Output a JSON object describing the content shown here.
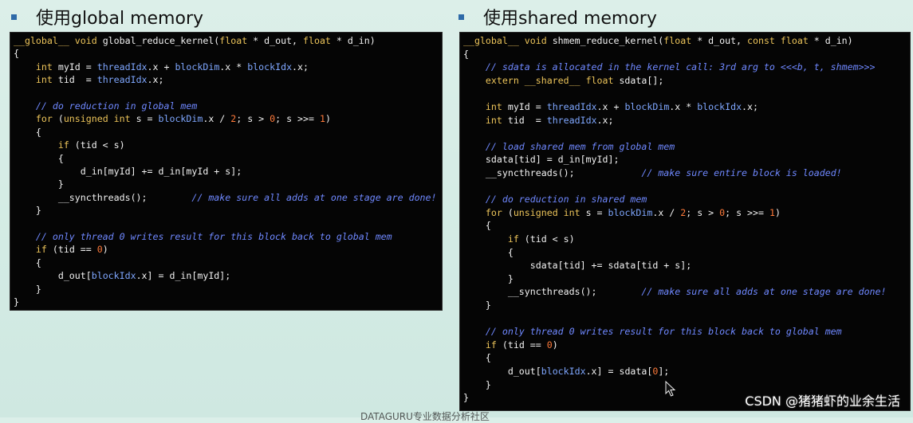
{
  "left_section": {
    "title": "使用global memory",
    "lines": [
      [
        [
          "kw",
          "__global__ "
        ],
        [
          "kw",
          "void "
        ],
        [
          "blk",
          "global_reduce_kernel("
        ],
        [
          "tp",
          "float "
        ],
        [
          "blk",
          "* d_out, "
        ],
        [
          "tp",
          "float "
        ],
        [
          "blk",
          "* d_in)"
        ]
      ],
      [
        [
          "blk",
          "{"
        ]
      ],
      [
        [
          "tp",
          "    int "
        ],
        [
          "blk",
          "myId = "
        ],
        [
          "bi",
          "threadIdx"
        ],
        [
          "blk",
          ".x + "
        ],
        [
          "bi",
          "blockDim"
        ],
        [
          "blk",
          ".x * "
        ],
        [
          "bi",
          "blockIdx"
        ],
        [
          "blk",
          ".x;"
        ]
      ],
      [
        [
          "tp",
          "    int "
        ],
        [
          "blk",
          "tid  = "
        ],
        [
          "bi",
          "threadIdx"
        ],
        [
          "blk",
          ".x;"
        ]
      ],
      [
        [
          "blk",
          ""
        ]
      ],
      [
        [
          "cm",
          "    // do reduction in global mem"
        ]
      ],
      [
        [
          "kw",
          "    for "
        ],
        [
          "blk",
          "("
        ],
        [
          "tp",
          "unsigned int "
        ],
        [
          "blk",
          "s = "
        ],
        [
          "bi",
          "blockDim"
        ],
        [
          "blk",
          ".x / "
        ],
        [
          "num",
          "2"
        ],
        [
          "blk",
          "; s > "
        ],
        [
          "num",
          "0"
        ],
        [
          "blk",
          "; s >>= "
        ],
        [
          "num",
          "1"
        ],
        [
          "blk",
          ")"
        ]
      ],
      [
        [
          "blk",
          "    {"
        ]
      ],
      [
        [
          "kw",
          "        if "
        ],
        [
          "blk",
          "(tid < s)"
        ]
      ],
      [
        [
          "blk",
          "        {"
        ]
      ],
      [
        [
          "blk",
          "            d_in[myId] += d_in[myId + s];"
        ]
      ],
      [
        [
          "blk",
          "        }"
        ]
      ],
      [
        [
          "blk",
          "        __syncthreads();        "
        ],
        [
          "cm",
          "// make sure all adds at one stage are done!"
        ]
      ],
      [
        [
          "blk",
          "    }"
        ]
      ],
      [
        [
          "blk",
          ""
        ]
      ],
      [
        [
          "cm",
          "    // only thread 0 writes result for this block back to global mem"
        ]
      ],
      [
        [
          "kw",
          "    if "
        ],
        [
          "blk",
          "(tid == "
        ],
        [
          "num",
          "0"
        ],
        [
          "blk",
          ")"
        ]
      ],
      [
        [
          "blk",
          "    {"
        ]
      ],
      [
        [
          "blk",
          "        d_out["
        ],
        [
          "bi",
          "blockIdx"
        ],
        [
          "blk",
          ".x] = d_in[myId];"
        ]
      ],
      [
        [
          "blk",
          "    }"
        ]
      ],
      [
        [
          "blk",
          "}"
        ]
      ]
    ]
  },
  "right_section": {
    "title": "使用shared memory",
    "lines": [
      [
        [
          "kw",
          "__global__ "
        ],
        [
          "kw",
          "void "
        ],
        [
          "blk",
          "shmem_reduce_kernel("
        ],
        [
          "tp",
          "float "
        ],
        [
          "blk",
          "* d_out, "
        ],
        [
          "tp",
          "const float "
        ],
        [
          "blk",
          "* d_in)"
        ]
      ],
      [
        [
          "blk",
          "{"
        ]
      ],
      [
        [
          "cm",
          "    // sdata is allocated in the kernel call: 3rd arg to <<<b, t, shmem>>>"
        ]
      ],
      [
        [
          "kw",
          "    extern __shared__ "
        ],
        [
          "tp",
          "float "
        ],
        [
          "blk",
          "sdata[];"
        ]
      ],
      [
        [
          "blk",
          ""
        ]
      ],
      [
        [
          "tp",
          "    int "
        ],
        [
          "blk",
          "myId = "
        ],
        [
          "bi",
          "threadIdx"
        ],
        [
          "blk",
          ".x + "
        ],
        [
          "bi",
          "blockDim"
        ],
        [
          "blk",
          ".x * "
        ],
        [
          "bi",
          "blockIdx"
        ],
        [
          "blk",
          ".x;"
        ]
      ],
      [
        [
          "tp",
          "    int "
        ],
        [
          "blk",
          "tid  = "
        ],
        [
          "bi",
          "threadIdx"
        ],
        [
          "blk",
          ".x;"
        ]
      ],
      [
        [
          "blk",
          ""
        ]
      ],
      [
        [
          "cm",
          "    // load shared mem from global mem"
        ]
      ],
      [
        [
          "blk",
          "    sdata[tid] = d_in[myId];"
        ]
      ],
      [
        [
          "blk",
          "    __syncthreads();            "
        ],
        [
          "cm",
          "// make sure entire block is loaded!"
        ]
      ],
      [
        [
          "blk",
          ""
        ]
      ],
      [
        [
          "cm",
          "    // do reduction in shared mem"
        ]
      ],
      [
        [
          "kw",
          "    for "
        ],
        [
          "blk",
          "("
        ],
        [
          "tp",
          "unsigned int "
        ],
        [
          "blk",
          "s = "
        ],
        [
          "bi",
          "blockDim"
        ],
        [
          "blk",
          ".x / "
        ],
        [
          "num",
          "2"
        ],
        [
          "blk",
          "; s > "
        ],
        [
          "num",
          "0"
        ],
        [
          "blk",
          "; s >>= "
        ],
        [
          "num",
          "1"
        ],
        [
          "blk",
          ")"
        ]
      ],
      [
        [
          "blk",
          "    {"
        ]
      ],
      [
        [
          "kw",
          "        if "
        ],
        [
          "blk",
          "(tid < s)"
        ]
      ],
      [
        [
          "blk",
          "        {"
        ]
      ],
      [
        [
          "blk",
          "            sdata[tid] += sdata[tid + s];"
        ]
      ],
      [
        [
          "blk",
          "        }"
        ]
      ],
      [
        [
          "blk",
          "        __syncthreads();        "
        ],
        [
          "cm",
          "// make sure all adds at one stage are done!"
        ]
      ],
      [
        [
          "blk",
          "    }"
        ]
      ],
      [
        [
          "blk",
          ""
        ]
      ],
      [
        [
          "cm",
          "    // only thread 0 writes result for this block back to global mem"
        ]
      ],
      [
        [
          "kw",
          "    if "
        ],
        [
          "blk",
          "(tid == "
        ],
        [
          "num",
          "0"
        ],
        [
          "blk",
          ")"
        ]
      ],
      [
        [
          "blk",
          "    {"
        ]
      ],
      [
        [
          "blk",
          "        d_out["
        ],
        [
          "bi",
          "blockIdx"
        ],
        [
          "blk",
          ".x] = sdata["
        ],
        [
          "num",
          "0"
        ],
        [
          "blk",
          "];"
        ]
      ],
      [
        [
          "blk",
          "    }"
        ]
      ],
      [
        [
          "blk",
          "}"
        ]
      ]
    ]
  },
  "watermark": "CSDN @猪猪虾的业余生活",
  "bottom_caption": "DATAGURU专业数据分析社区",
  "colors": {
    "keyword": "#ecc45a",
    "builtin": "#7fa7ff",
    "comment": "#6f88ff",
    "number": "#ff7a3a",
    "bullet": "#2e6aa8"
  }
}
